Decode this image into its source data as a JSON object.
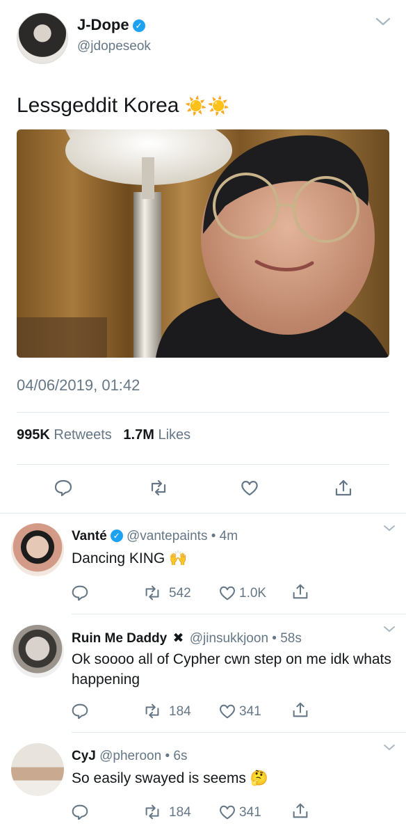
{
  "tweet": {
    "name": "J-Dope",
    "handle": "@jdopeseok",
    "text": "Lessgeddit Korea",
    "emoji": "☀️☀️",
    "date": "04/06/2019, 01:42",
    "retweets_count": "995K",
    "retweets_label": "Retweets",
    "likes_count": "1.7M",
    "likes_label": "Likes"
  },
  "replies": [
    {
      "name": "Vanté",
      "handle": "@vantepaints",
      "time": "• 4m",
      "text": "Dancing KING 🙌",
      "retweets": "542",
      "likes": "1.0K"
    },
    {
      "name": "Ruin Me Daddy",
      "handle": "@jinsukkjoon",
      "time": "• 58s",
      "text": "Ok soooo all of Cypher cwn step on me idk whats happening",
      "retweets": "184",
      "likes": "341"
    },
    {
      "name": "CyJ",
      "handle": "@pheroon",
      "time": "• 6s",
      "text": "So easily swayed is seems 🤔",
      "retweets": "184",
      "likes": "341"
    }
  ],
  "colors": {
    "verified": "#1da1f2",
    "muted": "#657786",
    "divider": "#e1e8ed"
  }
}
